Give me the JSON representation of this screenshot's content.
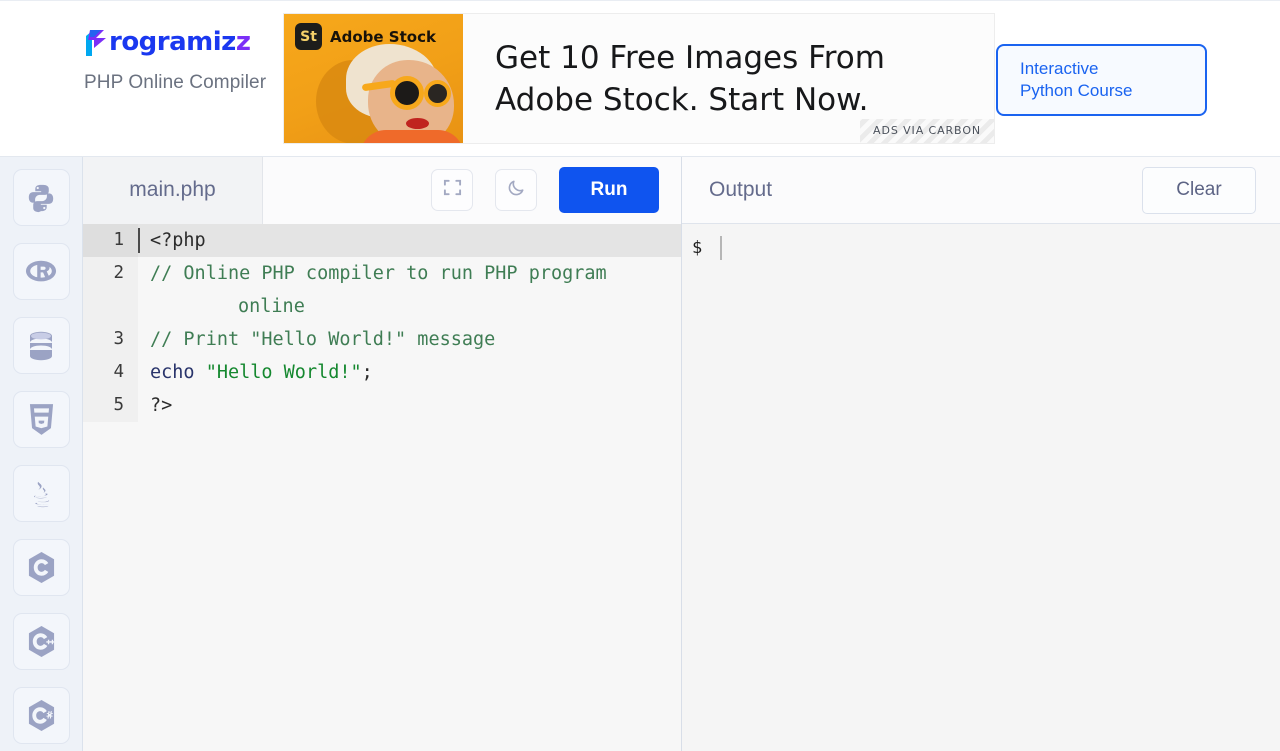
{
  "header": {
    "brand_name": "Programiz",
    "brand_name_lead": "P",
    "brand_name_rest": "rogramiz",
    "brand_name_tail": "z",
    "brand_subtitle": "PHP Online Compiler",
    "logo_icon": "programiz-logo-icon"
  },
  "ad": {
    "badge_text": "St",
    "brand_text": "Adobe Stock",
    "headline": "Get 10 Free Images From Adobe Stock. Start Now.",
    "attribution": "ADS VIA CARBON",
    "image_alt": "woman-with-sunglasses-photo",
    "bg_color": "#f7a81b"
  },
  "cta": {
    "label": "Interactive Python Course",
    "line1": "Interactive",
    "line2": "Python Course",
    "accent_color": "#1a63f0"
  },
  "sidebar": {
    "items": [
      {
        "name": "python",
        "icon": "python-icon",
        "label": "Python"
      },
      {
        "name": "r",
        "icon": "r-icon",
        "label": "R"
      },
      {
        "name": "sql",
        "icon": "database-icon",
        "label": "SQL"
      },
      {
        "name": "html",
        "icon": "html5-icon",
        "label": "HTML"
      },
      {
        "name": "java",
        "icon": "java-icon",
        "label": "Java"
      },
      {
        "name": "c",
        "icon": "c-icon",
        "label": "C"
      },
      {
        "name": "cpp",
        "icon": "cpp-icon",
        "label": "C++"
      },
      {
        "name": "csharp",
        "icon": "csharp-icon",
        "label": "C#"
      }
    ]
  },
  "editor": {
    "filename": "main.php",
    "fullscreen_icon": "fullscreen-icon",
    "theme_icon": "moon-icon",
    "run_label": "Run",
    "lines": [
      {
        "number": "1",
        "active": true
      },
      {
        "number": "2",
        "active": false
      },
      {
        "number": "3",
        "active": false
      },
      {
        "number": "4",
        "active": false
      },
      {
        "number": "5",
        "active": false
      }
    ],
    "code": {
      "line1": "<?php",
      "line2_a": "// Online PHP compiler to run PHP program",
      "line2_b": "online",
      "line3": "// Print \"Hello World!\" message",
      "line4_kw": "echo",
      "line4_str": "\"Hello World!\"",
      "line4_end": ";",
      "line5": "?>"
    },
    "colors": {
      "comment": "#3f7d54",
      "keyword": "#29346b",
      "string": "#15882f",
      "run_button": "#0f54ef"
    }
  },
  "output": {
    "title": "Output",
    "clear_label": "Clear",
    "prompt": "$",
    "content": ""
  }
}
